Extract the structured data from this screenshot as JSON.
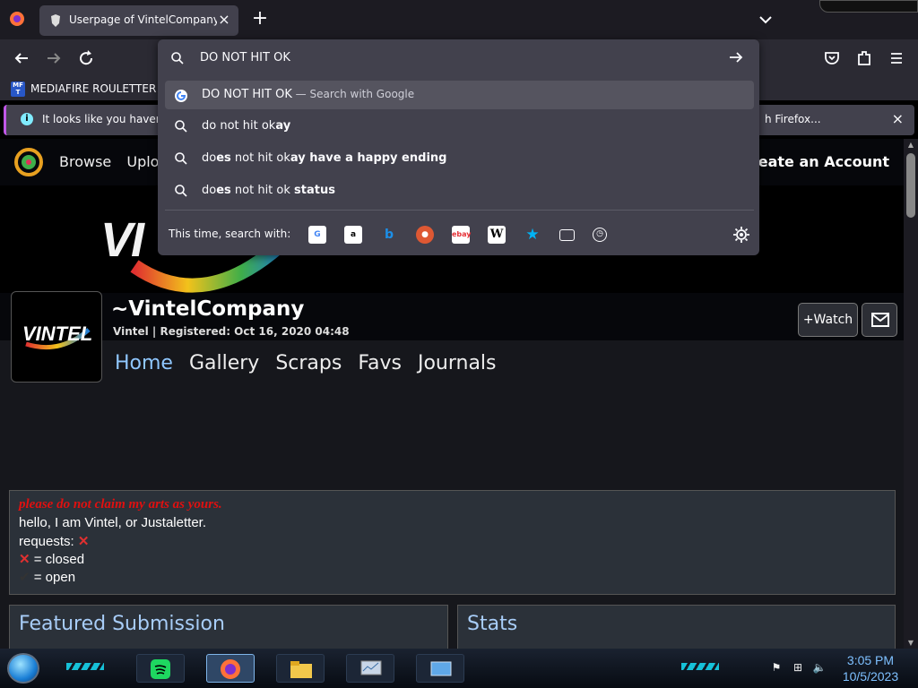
{
  "browser": {
    "tab_title": "Userpage of VintelCompany -- ",
    "url_query": "DO NOT HIT OK",
    "bookmark_label": "MEDIAFIRE ROULETTER",
    "bookmark_icon_text": "MF T",
    "notice_text_left": "It looks like you haven't s",
    "notice_text_right": "h Firefox..."
  },
  "urlbar": {
    "suggestions": [
      {
        "pre": "DO NOT HIT OK",
        "bold": "",
        "suffix": " — Search with Google",
        "selected": true
      },
      {
        "pre": "do not hit ok",
        "bold": "ay",
        "suffix": ""
      },
      {
        "pre": "do",
        "bold": "es",
        "mid": " not hit ok",
        "bold2": "ay have a happy ending"
      },
      {
        "pre": "do",
        "bold": "es",
        "mid": " not hit ok ",
        "bold2": "status"
      }
    ],
    "one_time_label": "This time, search with:",
    "engines": [
      "google",
      "amazon",
      "bing",
      "duckduckgo",
      "ebay",
      "wikipedia",
      "bookmarks",
      "tabs",
      "history"
    ]
  },
  "site": {
    "nav": [
      "Browse",
      "Uploa"
    ],
    "create_account": "Create an Account",
    "banner_text": "VI"
  },
  "profile": {
    "username": "~VintelCompany",
    "registered": "Vintel | Registered: Oct 16, 2020 04:48",
    "avatar_text": "VINTEL",
    "watch_label": "+Watch",
    "tabs": [
      "Home",
      "Gallery",
      "Scraps",
      "Favs",
      "Journals"
    ]
  },
  "about": {
    "line1": "please do not claim my arts as yours.",
    "line2": "hello, I am Vintel, or Justaletter.",
    "line3": "requests: ",
    "line4": " = closed",
    "line5": " = open"
  },
  "panels": {
    "featured": "Featured Submission",
    "stats": "Stats"
  },
  "taskbar": {
    "time": "3:05 PM",
    "date": "10/5/2023"
  },
  "colors": {
    "accent": "#8fc7ff",
    "panel": "#42414d",
    "about_red": "#e01010"
  }
}
